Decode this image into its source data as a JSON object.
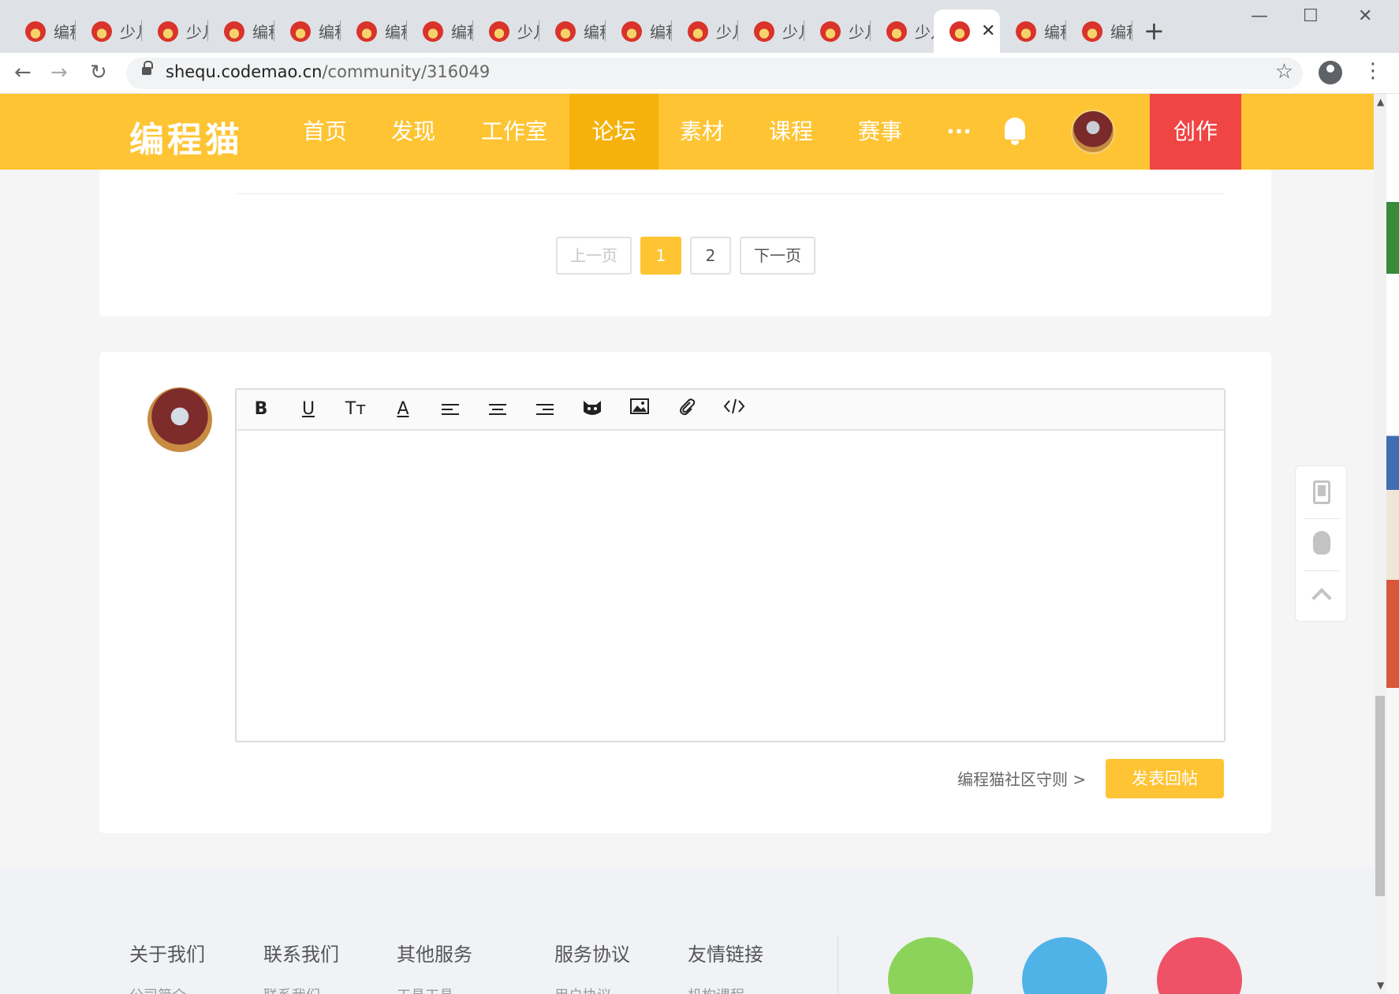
{
  "browser": {
    "tabs": [
      {
        "title": "编程"
      },
      {
        "title": "少儿"
      },
      {
        "title": "少儿"
      },
      {
        "title": "编程"
      },
      {
        "title": "编程"
      },
      {
        "title": "编程"
      },
      {
        "title": "编程"
      },
      {
        "title": "少儿"
      },
      {
        "title": "编程"
      },
      {
        "title": "编程"
      },
      {
        "title": "少儿"
      },
      {
        "title": "少儿"
      },
      {
        "title": "少儿"
      },
      {
        "title": "少儿"
      },
      {
        "title": "",
        "active": true
      },
      {
        "title": "编程"
      },
      {
        "title": "编程"
      }
    ],
    "url_host": "shequ.codemao.cn",
    "url_path": "/community/316049"
  },
  "header": {
    "logo": "编程猫",
    "nav": [
      {
        "label": "首页"
      },
      {
        "label": "发现"
      },
      {
        "label": "工作室"
      },
      {
        "label": "论坛",
        "active": true
      },
      {
        "label": "素材"
      },
      {
        "label": "课程"
      },
      {
        "label": "赛事"
      },
      {
        "label": "···"
      }
    ],
    "create_label": "创作",
    "brand_color": "#fec433",
    "create_color": "#ef4543"
  },
  "pagination": {
    "prev_label": "上一页",
    "pages": [
      "1",
      "2"
    ],
    "current": "1",
    "next_label": "下一页"
  },
  "editor": {
    "toolbar": {
      "bold": "B",
      "underline": "U",
      "text_size": "Tт",
      "text_color": "A"
    },
    "content": ""
  },
  "reply": {
    "rules_link": "编程猫社区守则 >",
    "submit_label": "发表回帖"
  },
  "footer": {
    "columns": [
      {
        "title": "关于我们",
        "sub": "公司简介"
      },
      {
        "title": "联系我们",
        "sub": "联系我们"
      },
      {
        "title": "其他服务",
        "sub": "工具工具"
      },
      {
        "title": "服务协议",
        "sub": "用户协议"
      },
      {
        "title": "友情链接",
        "sub": "机构课程"
      }
    ],
    "social_colors": {
      "wechat": "#8bd35a",
      "qq": "#4fb3e8",
      "weibo": "#ef5266"
    }
  }
}
